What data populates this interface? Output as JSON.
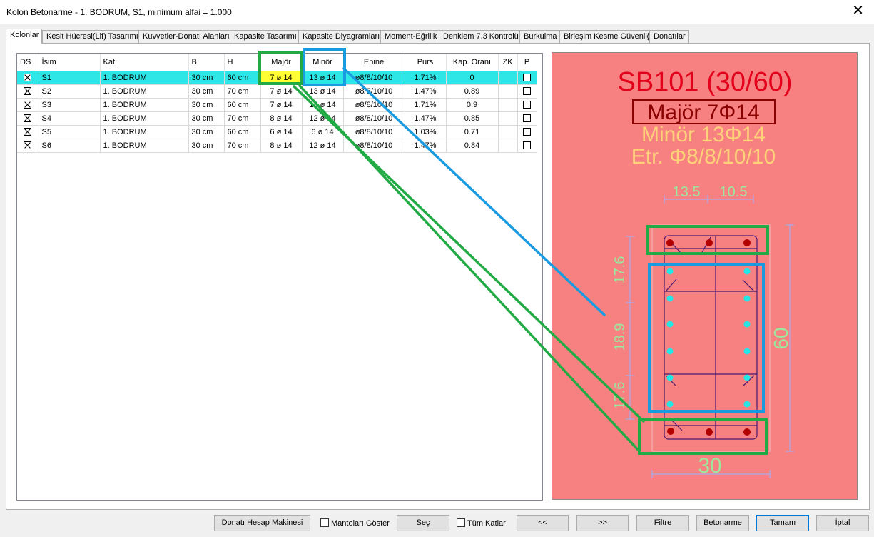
{
  "window": {
    "title": "Kolon Betonarme - 1. BODRUM, S1, minimum alfai = 1.000"
  },
  "tabs": [
    "Kolonlar",
    "Kesit Hücresi(Lif) Tasarımı",
    "Kuvvetler-Donatı Alanları",
    "Kapasite Tasarımı",
    "Kapasite Diyagramları",
    "Moment-Eğrilik",
    "Denklem 7.3 Kontrolü",
    "Burkulma",
    "Birleşim Kesme Güvenliği",
    "Donatılar"
  ],
  "table": {
    "columns": [
      "DS",
      "İsim",
      "Kat",
      "B",
      "H",
      "Majör",
      "Minör",
      "Enine",
      "Purs",
      "Kap. Oranı",
      "ZK",
      "P"
    ],
    "rows": [
      {
        "ds": true,
        "name": "S1",
        "floor": "1. BODRUM",
        "b": "30 cm",
        "h": "60 cm",
        "major": "7 ø 14",
        "minor": "13 ø 14",
        "enine": "ø8/8/10/10",
        "purs": "1.71%",
        "ratio": "0",
        "zk": "",
        "p": false
      },
      {
        "ds": true,
        "name": "S2",
        "floor": "1. BODRUM",
        "b": "30 cm",
        "h": "70 cm",
        "major": "7 ø 14",
        "minor": "13 ø 14",
        "enine": "ø8/8/10/10",
        "purs": "1.47%",
        "ratio": "0.89",
        "zk": "",
        "p": false
      },
      {
        "ds": true,
        "name": "S3",
        "floor": "1. BODRUM",
        "b": "30 cm",
        "h": "60 cm",
        "major": "7 ø 14",
        "minor": "13 ø 14",
        "enine": "ø8/8/10/10",
        "purs": "1.71%",
        "ratio": "0.9",
        "zk": "",
        "p": false
      },
      {
        "ds": true,
        "name": "S4",
        "floor": "1. BODRUM",
        "b": "30 cm",
        "h": "70 cm",
        "major": "8 ø 14",
        "minor": "12 ø 14",
        "enine": "ø8/8/10/10",
        "purs": "1.47%",
        "ratio": "0.85",
        "zk": "",
        "p": false
      },
      {
        "ds": true,
        "name": "S5",
        "floor": "1. BODRUM",
        "b": "30 cm",
        "h": "60 cm",
        "major": "6 ø 14",
        "minor": "6 ø 14",
        "enine": "ø8/8/10/10",
        "purs": "1.03%",
        "ratio": "0.71",
        "zk": "",
        "p": false
      },
      {
        "ds": true,
        "name": "S6",
        "floor": "1. BODRUM",
        "b": "30 cm",
        "h": "70 cm",
        "major": "8 ø 14",
        "minor": "12 ø 14",
        "enine": "ø8/8/10/10",
        "purs": "1.47%",
        "ratio": "0.84",
        "zk": "",
        "p": false
      }
    ]
  },
  "drawing": {
    "title": "SB101 (30/60)",
    "major": "Majör 7Φ14",
    "minor": "Minör 13Φ14",
    "stirrup": "Etr. Φ8/8/10/10",
    "dim_top_left": "13.5",
    "dim_top_right": "10.5",
    "dim_left_top": "17.6",
    "dim_left_mid": "18.9",
    "dim_left_bottom": "17.6",
    "dim_height": "60",
    "dim_width": "30",
    "colors": {
      "background": "#f78080",
      "title": "#e3001b",
      "major": "#8b0000",
      "minor": "#ffd27a",
      "dim": "#9de89d",
      "bar_major": "#b30000",
      "bar_minor": "#23e6e6"
    }
  },
  "footer": {
    "calc_button": "Donatı Hesap Makinesi",
    "mantolar_label": "Mantoları Göster",
    "sec_button": "Seç",
    "tum_katlar_label": "Tüm Katlar",
    "prev_button": "<<",
    "next_button": ">>",
    "filter_button": "Filtre",
    "betonarme_button": "Betonarme",
    "ok_button": "Tamam",
    "cancel_button": "İptal"
  }
}
